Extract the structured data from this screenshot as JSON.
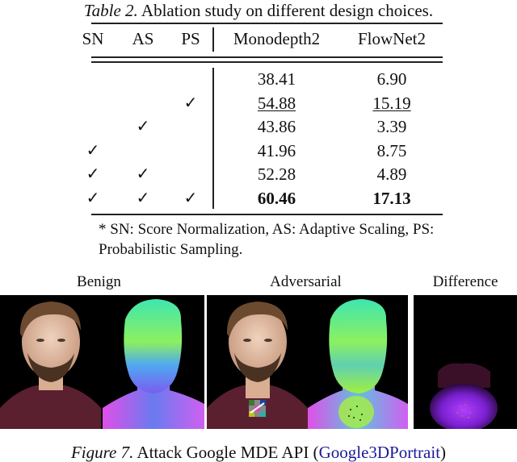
{
  "table": {
    "caption_label": "Table 2.",
    "caption_text": " Ablation study on different design choices.",
    "headers": [
      "SN",
      "AS",
      "PS",
      "Monodepth2",
      "FlowNet2"
    ],
    "check_glyph": "✓",
    "rows": [
      {
        "sn": "",
        "as": "",
        "ps": "",
        "monodepth2": "38.41",
        "flownet2": "6.90"
      },
      {
        "sn": "",
        "as": "",
        "ps": "✓",
        "monodepth2": "54.88",
        "flownet2": "15.19"
      },
      {
        "sn": "",
        "as": "✓",
        "ps": "",
        "monodepth2": "43.86",
        "flownet2": "3.39"
      },
      {
        "sn": "✓",
        "as": "",
        "ps": "",
        "monodepth2": "41.96",
        "flownet2": "8.75"
      },
      {
        "sn": "✓",
        "as": "✓",
        "ps": "",
        "monodepth2": "52.28",
        "flownet2": "4.89"
      },
      {
        "sn": "✓",
        "as": "✓",
        "ps": "✓",
        "monodepth2": "60.46",
        "flownet2": "17.13"
      }
    ],
    "underlined_row": 1,
    "bold_row": 5,
    "footnote": "* SN: Score Normalization, AS: Adaptive Scaling, PS: Probabilistic Sampling."
  },
  "figure": {
    "labels": {
      "benign": "Benign",
      "adversarial": "Adversarial",
      "difference": "Difference"
    },
    "caption_label": "Figure 7.",
    "caption_text": " Attack Google MDE API (",
    "caption_link": "Google3DPortrait",
    "caption_end": ")",
    "colors": {
      "link": "#1a1a9a",
      "shirt": "#5a2030",
      "skin": "#e6c2a8",
      "hair": "#6b4a30"
    }
  }
}
